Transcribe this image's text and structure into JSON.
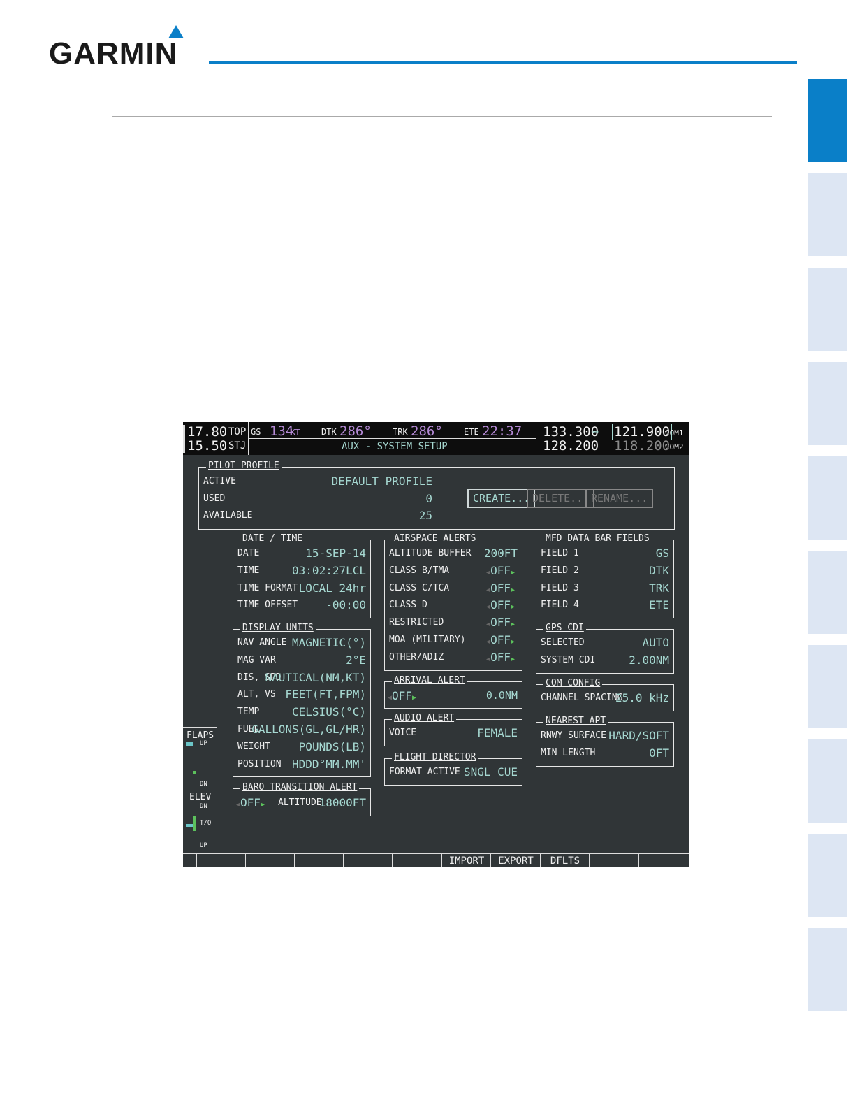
{
  "header": {
    "logo": "GARMIN"
  },
  "top": {
    "left_freq1": "17.80",
    "left_id1": "TOP",
    "left_freq2": "15.50",
    "left_id2": "STJ",
    "gs_label": "GS",
    "gs_value": "134",
    "gs_unit": "KT",
    "dtk_label": "DTK",
    "dtk_value": "286°",
    "trk_label": "TRK",
    "trk_value": "286°",
    "ete_label": "ETE",
    "ete_value": "22:37",
    "page_title": "AUX - SYSTEM SETUP",
    "com1_standby": "133.300",
    "swap": "↔",
    "com1_active": "121.900",
    "com1_label": "COM1",
    "com2_standby": "128.200",
    "com2_active": "118.200",
    "com2_label": "COM2"
  },
  "pilot_profile": {
    "title": "PILOT PROFILE",
    "rows": [
      {
        "label": "ACTIVE",
        "value": "DEFAULT PROFILE"
      },
      {
        "label": "USED",
        "value": "0"
      },
      {
        "label": "AVAILABLE",
        "value": "25"
      }
    ],
    "create": "CREATE...",
    "delete": "DELETE...",
    "rename": "RENAME..."
  },
  "panels": [
    {
      "id": "date-time",
      "title": "DATE / TIME",
      "rows": [
        [
          "DATE",
          "15-SEP-14"
        ],
        [
          "TIME",
          "03:02:27LCL"
        ],
        [
          "TIME FORMAT",
          "LOCAL 24hr"
        ],
        [
          "TIME OFFSET",
          "-00:00"
        ]
      ]
    },
    {
      "id": "display-units",
      "title": "DISPLAY UNITS",
      "rows": [
        [
          "NAV ANGLE",
          "MAGNETIC(°)"
        ],
        [
          "MAG VAR",
          "2°E"
        ],
        [
          "DIS, SPD",
          "NAUTICAL(NM,KT)"
        ],
        [
          "ALT, VS",
          "FEET(FT,FPM)"
        ],
        [
          "TEMP",
          "CELSIUS(°C)"
        ],
        [
          "FUEL",
          "GALLONS(GL,GL/HR)"
        ],
        [
          "WEIGHT",
          "POUNDS(LB)"
        ],
        [
          "POSITION",
          "HDDD°MM.MM'"
        ]
      ]
    },
    {
      "id": "airspace-alerts",
      "title": "AIRSPACE ALERTS",
      "rows": [
        [
          "ALTITUDE BUFFER",
          "200FT"
        ],
        [
          "CLASS B/TMA",
          "OFF",
          "sel"
        ],
        [
          "CLASS C/TCA",
          "OFF",
          "sel"
        ],
        [
          "CLASS D",
          "OFF",
          "sel"
        ],
        [
          "RESTRICTED",
          "OFF",
          "sel"
        ],
        [
          "MOA (MILITARY)",
          "OFF",
          "sel"
        ],
        [
          "OTHER/ADIZ",
          "OFF",
          "sel"
        ]
      ]
    },
    {
      "id": "audio-alert",
      "title": "AUDIO ALERT",
      "rows": [
        [
          "VOICE",
          "FEMALE"
        ]
      ]
    },
    {
      "id": "flight-director",
      "title": "FLIGHT DIRECTOR",
      "rows": [
        [
          "FORMAT ACTIVE",
          "SNGL CUE"
        ]
      ]
    },
    {
      "id": "mfd-data-bar-fields",
      "title": "MFD DATA BAR FIELDS",
      "rows": [
        [
          "FIELD 1",
          "GS"
        ],
        [
          "FIELD 2",
          "DTK"
        ],
        [
          "FIELD 3",
          "TRK"
        ],
        [
          "FIELD 4",
          "ETE"
        ]
      ]
    },
    {
      "id": "gps-cdi",
      "title": "GPS CDI",
      "rows": [
        [
          "SELECTED",
          "AUTO"
        ],
        [
          "SYSTEM CDI",
          "2.00NM"
        ]
      ]
    },
    {
      "id": "com-config",
      "title": "COM CONFIG",
      "rows": [
        [
          "CHANNEL SPACING",
          "25.0 kHz"
        ]
      ]
    },
    {
      "id": "nearest-apt",
      "title": "NEAREST APT",
      "rows": [
        [
          "RNWY SURFACE",
          "HARD/SOFT"
        ],
        [
          "MIN LENGTH",
          "0FT"
        ]
      ]
    }
  ],
  "arrival_alert": {
    "title": "ARRIVAL ALERT",
    "state": "OFF",
    "distance": "0.0NM"
  },
  "baro": {
    "title": "BARO TRANSITION ALERT",
    "state": "OFF",
    "alt_label": "ALTITUDE",
    "alt_value": "18000FT"
  },
  "trim": {
    "flaps": "FLAPS",
    "flaps_up": "UP",
    "flaps_dn": "DN",
    "elev": "ELEV",
    "elev_dn": "DN",
    "elev_to": "T/O",
    "elev_up": "UP"
  },
  "softkeys": [
    "",
    "",
    "",
    "",
    "",
    "IMPORT",
    "EXPORT",
    "DFLTS",
    "",
    ""
  ]
}
